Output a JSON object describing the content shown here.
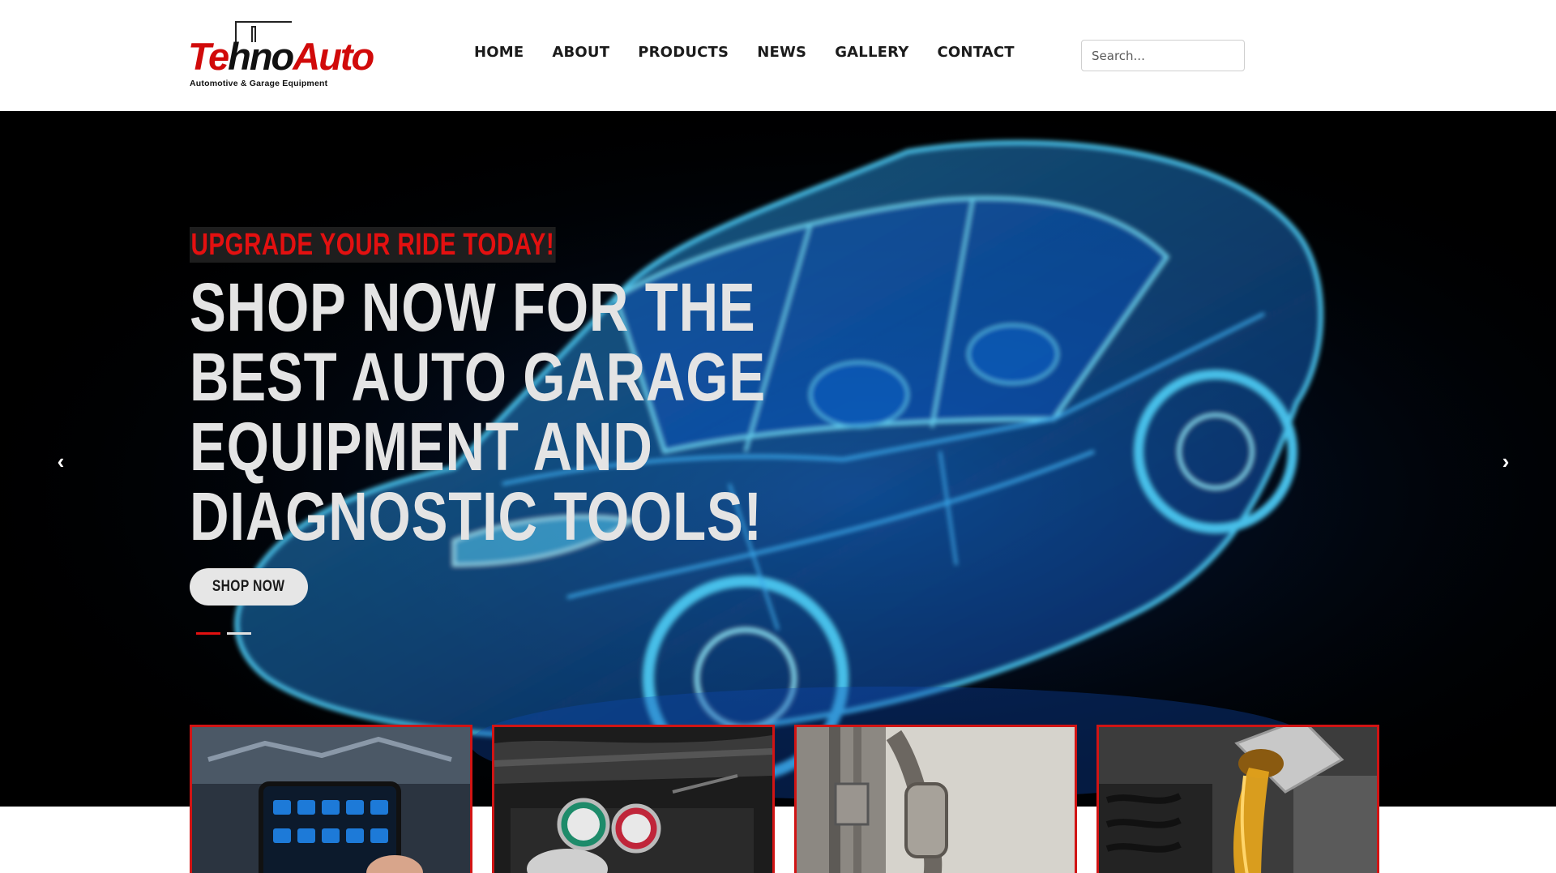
{
  "brand": {
    "logo_text_red_1": "Te",
    "logo_text_dark": "hno",
    "logo_text_red_2": "Auto",
    "tagline": "Automotive & Garage Equipment"
  },
  "nav": {
    "items": [
      {
        "label": "HOME"
      },
      {
        "label": "ABOUT"
      },
      {
        "label": "PRODUCTS"
      },
      {
        "label": "NEWS"
      },
      {
        "label": "GALLERY"
      },
      {
        "label": "CONTACT"
      }
    ]
  },
  "search": {
    "placeholder": "Search..."
  },
  "hero": {
    "kicker": "UPGRADE YOUR RIDE TODAY!",
    "headline_lines": [
      "SHOP NOW FOR THE",
      "BEST AUTO GARAGE",
      "EQUIPMENT AND",
      "DIAGNOSTIC TOOLS!"
    ],
    "button_label": "SHOP NOW",
    "prev_icon": "chevron-left-icon",
    "next_icon": "chevron-right-icon",
    "slides_count": 2,
    "active_slide": 1
  },
  "cards": [
    {
      "image": "diagnostic-tablet-engine"
    },
    {
      "image": "ac-manifold-gauges"
    },
    {
      "image": "exhaust-catalytic-converter"
    },
    {
      "image": "engine-oil-pour"
    }
  ],
  "colors": {
    "accent_red": "#e31010",
    "card_border": "#d11414",
    "hero_bg": "#000000",
    "car_glow": "#1e8bff"
  }
}
